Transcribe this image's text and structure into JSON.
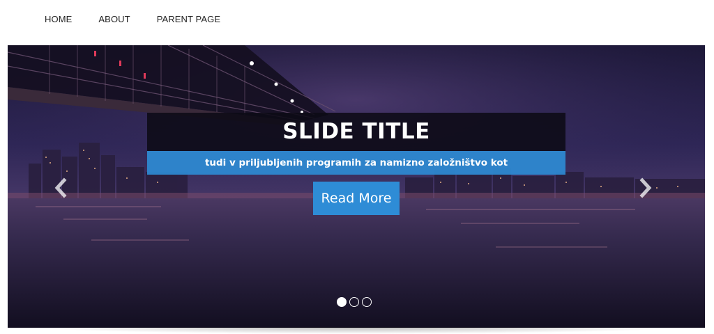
{
  "nav": {
    "items": [
      {
        "label": "HOME"
      },
      {
        "label": "ABOUT"
      },
      {
        "label": "PARENT PAGE"
      }
    ]
  },
  "slider": {
    "title": "SLIDE TITLE",
    "subtitle": "tudi v priljubljenih programih za namizno založništvo kot",
    "button_label": "Read More",
    "slide_count": 3,
    "active_slide": 1,
    "colors": {
      "title_bg": "#0c0a16",
      "subtitle_bg": "#2e8bd4",
      "button_bg": "#2e8cd6",
      "sky": "#2a2250"
    },
    "icons": {
      "prev": "chevron-left-icon",
      "next": "chevron-right-icon"
    }
  }
}
